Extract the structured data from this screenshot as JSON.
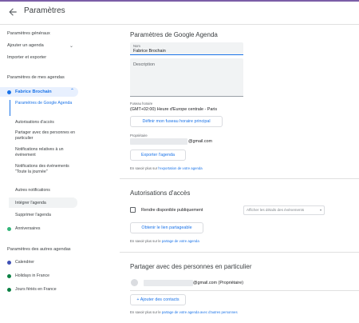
{
  "header": {
    "title": "Paramètres"
  },
  "sidebar": {
    "general": "Paramètres généraux",
    "add_calendar": "Ajouter un agenda",
    "import_export": "Importer et exporter",
    "my_calendars_heading": "Paramètres de mes agendas",
    "selected_calendar": "Fabrice Brochain",
    "sub_items": [
      "Paramètres de Google Agenda",
      "Autorisations d'accès",
      "Partager avec des personnes en particulier",
      "Notifications relatives à un événement",
      "Notifications des événements \"Toute la journée\"",
      "Autres notifications",
      "Intégrer l'agenda",
      "Supprimer l'agenda"
    ],
    "anniversaires": "Anniversaires",
    "other_calendars_heading": "Paramètres des autres agendas",
    "other_calendars": [
      "Calendrier",
      "Holidays in France",
      "Jours fériés en France"
    ]
  },
  "colors": {
    "selected_calendar": "#1a73e8",
    "anniversaires": "#33b679",
    "calendrier": "#3f51b5",
    "holidays": "#0b8043",
    "jours_feries": "#0b8043"
  },
  "main": {
    "settings_title": "Paramètres de Google Agenda",
    "name_label": "Nom",
    "name_value": "Fabrice Brochain",
    "description_placeholder": "Description",
    "timezone_label": "Fuseau horaire",
    "timezone_value": "(GMT+02:00) Heure d'Europe centrale - Paris",
    "timezone_button": "Définir mon fuseau horaire principal",
    "owner_label": "Propriétaire",
    "owner_email": "@gmail.com",
    "export_button": "Exporter l'agenda",
    "export_hint_prefix": "En savoir plus sur ",
    "export_hint_link": "l'exportation de votre agenda",
    "access_title": "Autorisations d'accès",
    "public_label": "Rendre disponible publiquement",
    "public_select": "Afficher les détails des événements",
    "share_link_button": "Obtenir le lien partageable",
    "share_hint_prefix": "En savoir plus sur le ",
    "share_hint_link": "partage de votre agenda",
    "people_title": "Partager avec des personnes en particulier",
    "owner_entry": "@gmail.com (Propriétaire)",
    "add_people_button": "+ Ajouter des contacts",
    "people_hint_prefix": "En savoir plus sur le ",
    "people_hint_link": "partage de votre agenda avec d'autres personnes"
  }
}
